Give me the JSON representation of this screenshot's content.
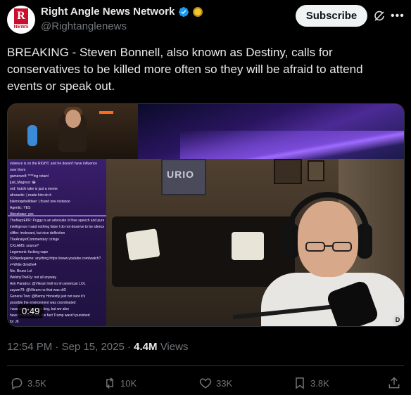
{
  "account": {
    "name": "Right Angle News Network",
    "handle": "@Rightanglenews",
    "avatar_letter": "R",
    "avatar_text": "NEWS",
    "brand_color": "#c8102e",
    "verified_color": "#1d9bf0"
  },
  "header": {
    "subscribe_label": "Subscribe",
    "grok_icon": "grok-icon",
    "more_icon": "more-icon"
  },
  "tweet": {
    "text": "BREAKING - Steven Bonnell, also known as Destiny, calls for conservatives to be killed more often so they will be afraid to attend events or speak out."
  },
  "media": {
    "duration": "0:49",
    "corner_badge": "D",
    "poster_text": "URIO",
    "chat_lines": [
      "violence is on the RIGHT, and he doesn't have influence",
      "over them",
      "gamerwolf: ****ing retard",
      "just_Magnus: 😂",
      "ord: hatchi take is just a meme",
      "afroraztic: | made him do it",
      "lolemoqehelldaer: | found one instance",
      "Agentic: YES",
      "Alexstrasz: yes",
      "TheNeprEPR: Puggy is an advocate of free speech and pure",
      "intelligence I said nothing false I do not deserve to be silenced.",
      "cliffer: irrelevant, but nice deflection",
      "TheAnalystCommentary: cringe",
      "CXLAMS: source?",
      "Legemonk: fucking vape",
      "KRApnlegaime: anything https://www.youtube.com/watch?",
      "v=Wdie-3imdhe4",
      "Nic: Bruno Lol",
      "WelshyTheFly: not all anyway",
      "Aim Paradox: @Vikram hell no im american LOL",
      "zayum79: @Vikram no that was drD",
      "General Two: @Benny Honestly just not sure it's",
      "possible the environment was coordinated",
      "i was unable to it working, but we also",
      "have to reckon with the fact Trump wasn't punished",
      "for J6"
    ]
  },
  "meta": {
    "time": "12:54 PM",
    "separator": "·",
    "date": "Sep 15, 2025",
    "views_count": "4.4M",
    "views_label": "Views"
  },
  "actions": {
    "replies": "3.5K",
    "reposts": "10K",
    "likes": "33K",
    "bookmarks": "3.8K"
  }
}
